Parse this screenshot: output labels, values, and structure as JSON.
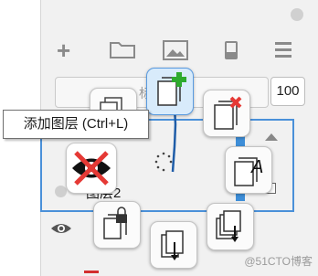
{
  "panel": {
    "opacity_value": "100",
    "bar_letter": "标",
    "layer_name": "图层2"
  },
  "tooltip": {
    "text": "添加图层 (Ctrl+L)"
  },
  "toolbar": {
    "icons": [
      "add-icon",
      "folder-icon",
      "image-icon",
      "trash-icon",
      "menu-icon"
    ]
  },
  "radial_menu": {
    "buttons": [
      "add-layer",
      "delete-layer",
      "copy-layer",
      "text-layer",
      "lock-layer",
      "merge-down",
      "duplicate-down"
    ],
    "center_letter": "A"
  },
  "watermark": "@51CTO博客",
  "colors": {
    "accent_blue": "#4a90d9",
    "add_green": "#2eaa2e",
    "delete_red": "#e53935",
    "hidden_red": "#d32f2f"
  }
}
